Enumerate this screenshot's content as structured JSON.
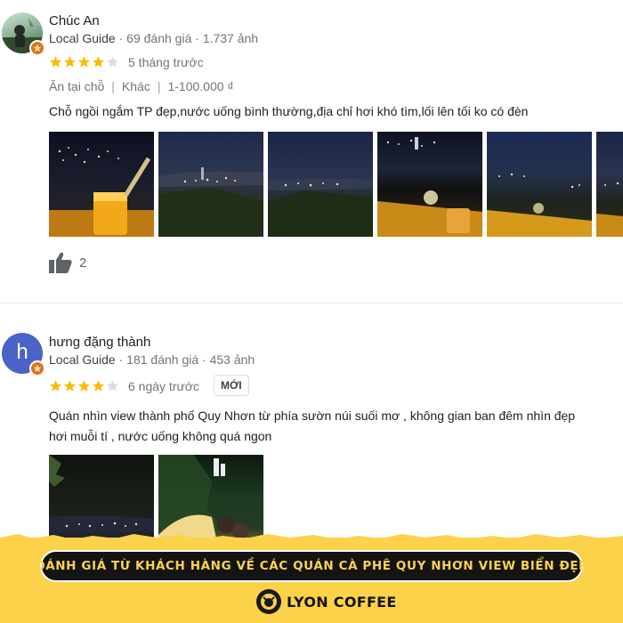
{
  "reviews": [
    {
      "author": "Chúc An",
      "local_guide": "Local Guide",
      "review_count": "69 đánh giá",
      "photo_count": "1.737 ảnh",
      "rating": 4,
      "time": "5 tháng trước",
      "tags": [
        "Ăn tại chỗ",
        "Khác",
        "1-100.000 ₫"
      ],
      "text_lines": [
        "Chỗ ngồi ngắm TP đẹp,nước uống bình thường,địa chỉ hơi khó tìm,lối lên tối ko có đèn"
      ],
      "likes": "2"
    },
    {
      "author": "hưng đặng thành",
      "avatar_letter": "h",
      "local_guide": "Local Guide",
      "review_count": "181 đánh giá",
      "photo_count": "453 ảnh",
      "rating": 4,
      "time": "6 ngày trước",
      "new_badge": "MỚI",
      "text_lines": [
        "Quán nhìn view thành phố Quy Nhơn từ phía sườn núi suối mơ , không gian ban đêm nhìn đẹp",
        "hơi muỗi tí , nước uống không quá ngon"
      ]
    }
  ],
  "banner": {
    "title": "ĐÁNH GIÁ TỪ KHÁCH HÀNG VỀ CÁC QUÁN CÀ PHÊ QUY NHƠN VIEW BIỂN ĐẸP",
    "brand": "LYON COFFEE"
  },
  "colors": {
    "star": "#fbbc04",
    "star_empty": "#dadce0",
    "avatar_h": "#4a63c7",
    "banner_bg": "#fbd24a",
    "local_guide_badge": "#e8710a"
  },
  "icons": [
    "local-guide-badge-icon",
    "star-icon",
    "thumbs-up-icon",
    "lyon-logo-icon"
  ]
}
